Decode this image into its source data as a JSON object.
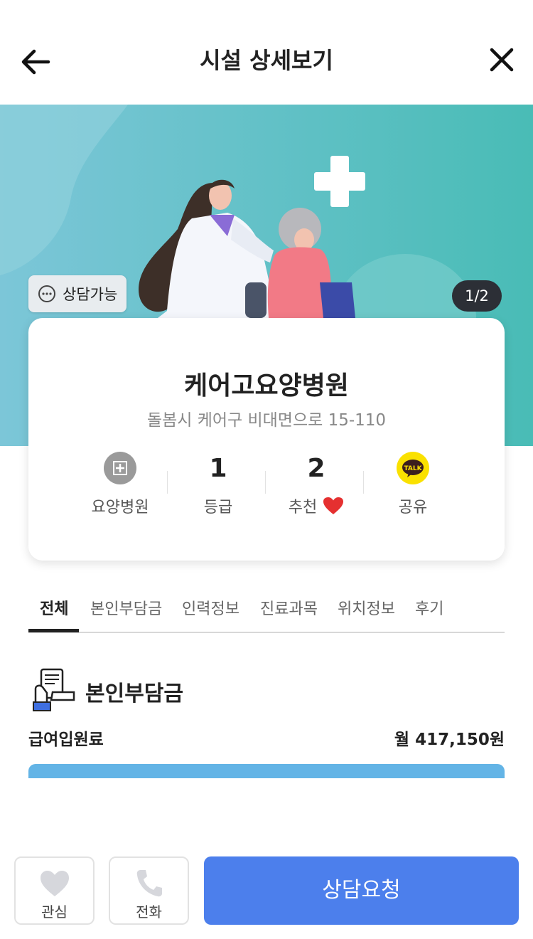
{
  "header": {
    "title": "시설 상세보기"
  },
  "hero": {
    "consult_badge": "상담가능",
    "pager": "1/2"
  },
  "facility": {
    "name": "케어고요양병원",
    "address": "돌봄시 케어구 비대면으로 15-110",
    "stats": [
      {
        "value": "",
        "label": "요양병원",
        "icon": "hospital-icon"
      },
      {
        "value": "1",
        "label": "등급"
      },
      {
        "value": "2",
        "label": "추천",
        "icon": "heart-icon"
      },
      {
        "value": "",
        "label": "공유",
        "icon": "kakaotalk-icon",
        "icon_text": "TALK"
      }
    ]
  },
  "tabs": [
    "전체",
    "본인부담금",
    "인력정보",
    "진료과목",
    "위치정보",
    "후기"
  ],
  "section": {
    "title": "본인부담금",
    "row_label": "급여입원료",
    "row_value": "월 417,150원"
  },
  "bottom": {
    "interest": "관심",
    "call": "전화",
    "cta": "상담요청"
  },
  "colors": {
    "accent": "#4c7fec",
    "hero_bg": "#5ec0c8",
    "bar": "#63b4e6",
    "kakao": "#fae100",
    "heart": "#e53030"
  }
}
